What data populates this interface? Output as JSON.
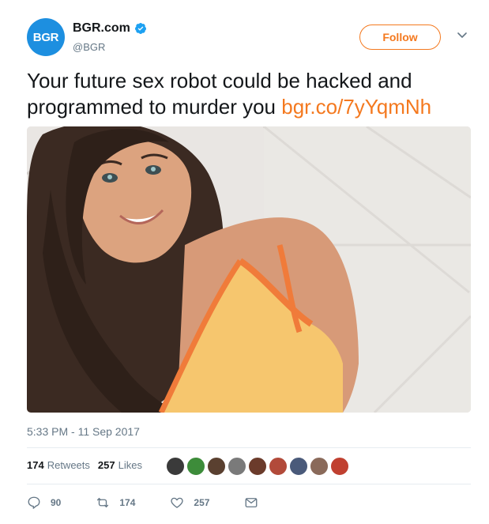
{
  "account": {
    "avatar_text": "BGR",
    "display_name": "BGR.com",
    "handle": "@BGR",
    "verified_icon": "verified-badge-icon"
  },
  "follow_button": {
    "label": "Follow"
  },
  "tweet": {
    "text": "Your future sex robot could be hacked and programmed to murder you",
    "link": "bgr.co/7yYqmNh",
    "timestamp": "5:33 PM - 11 Sep 2017"
  },
  "stats": {
    "retweets_count": "174",
    "retweets_label": "Retweets",
    "likes_count": "257",
    "likes_label": "Likes",
    "liker_avatar_count": 10
  },
  "actions": {
    "replies": "90",
    "retweets": "174",
    "likes": "257"
  },
  "colors": {
    "accent": "#f4791f",
    "avatar_bg": "#1d8fe0",
    "verified": "#1da1f2",
    "secondary_text": "#657786"
  }
}
